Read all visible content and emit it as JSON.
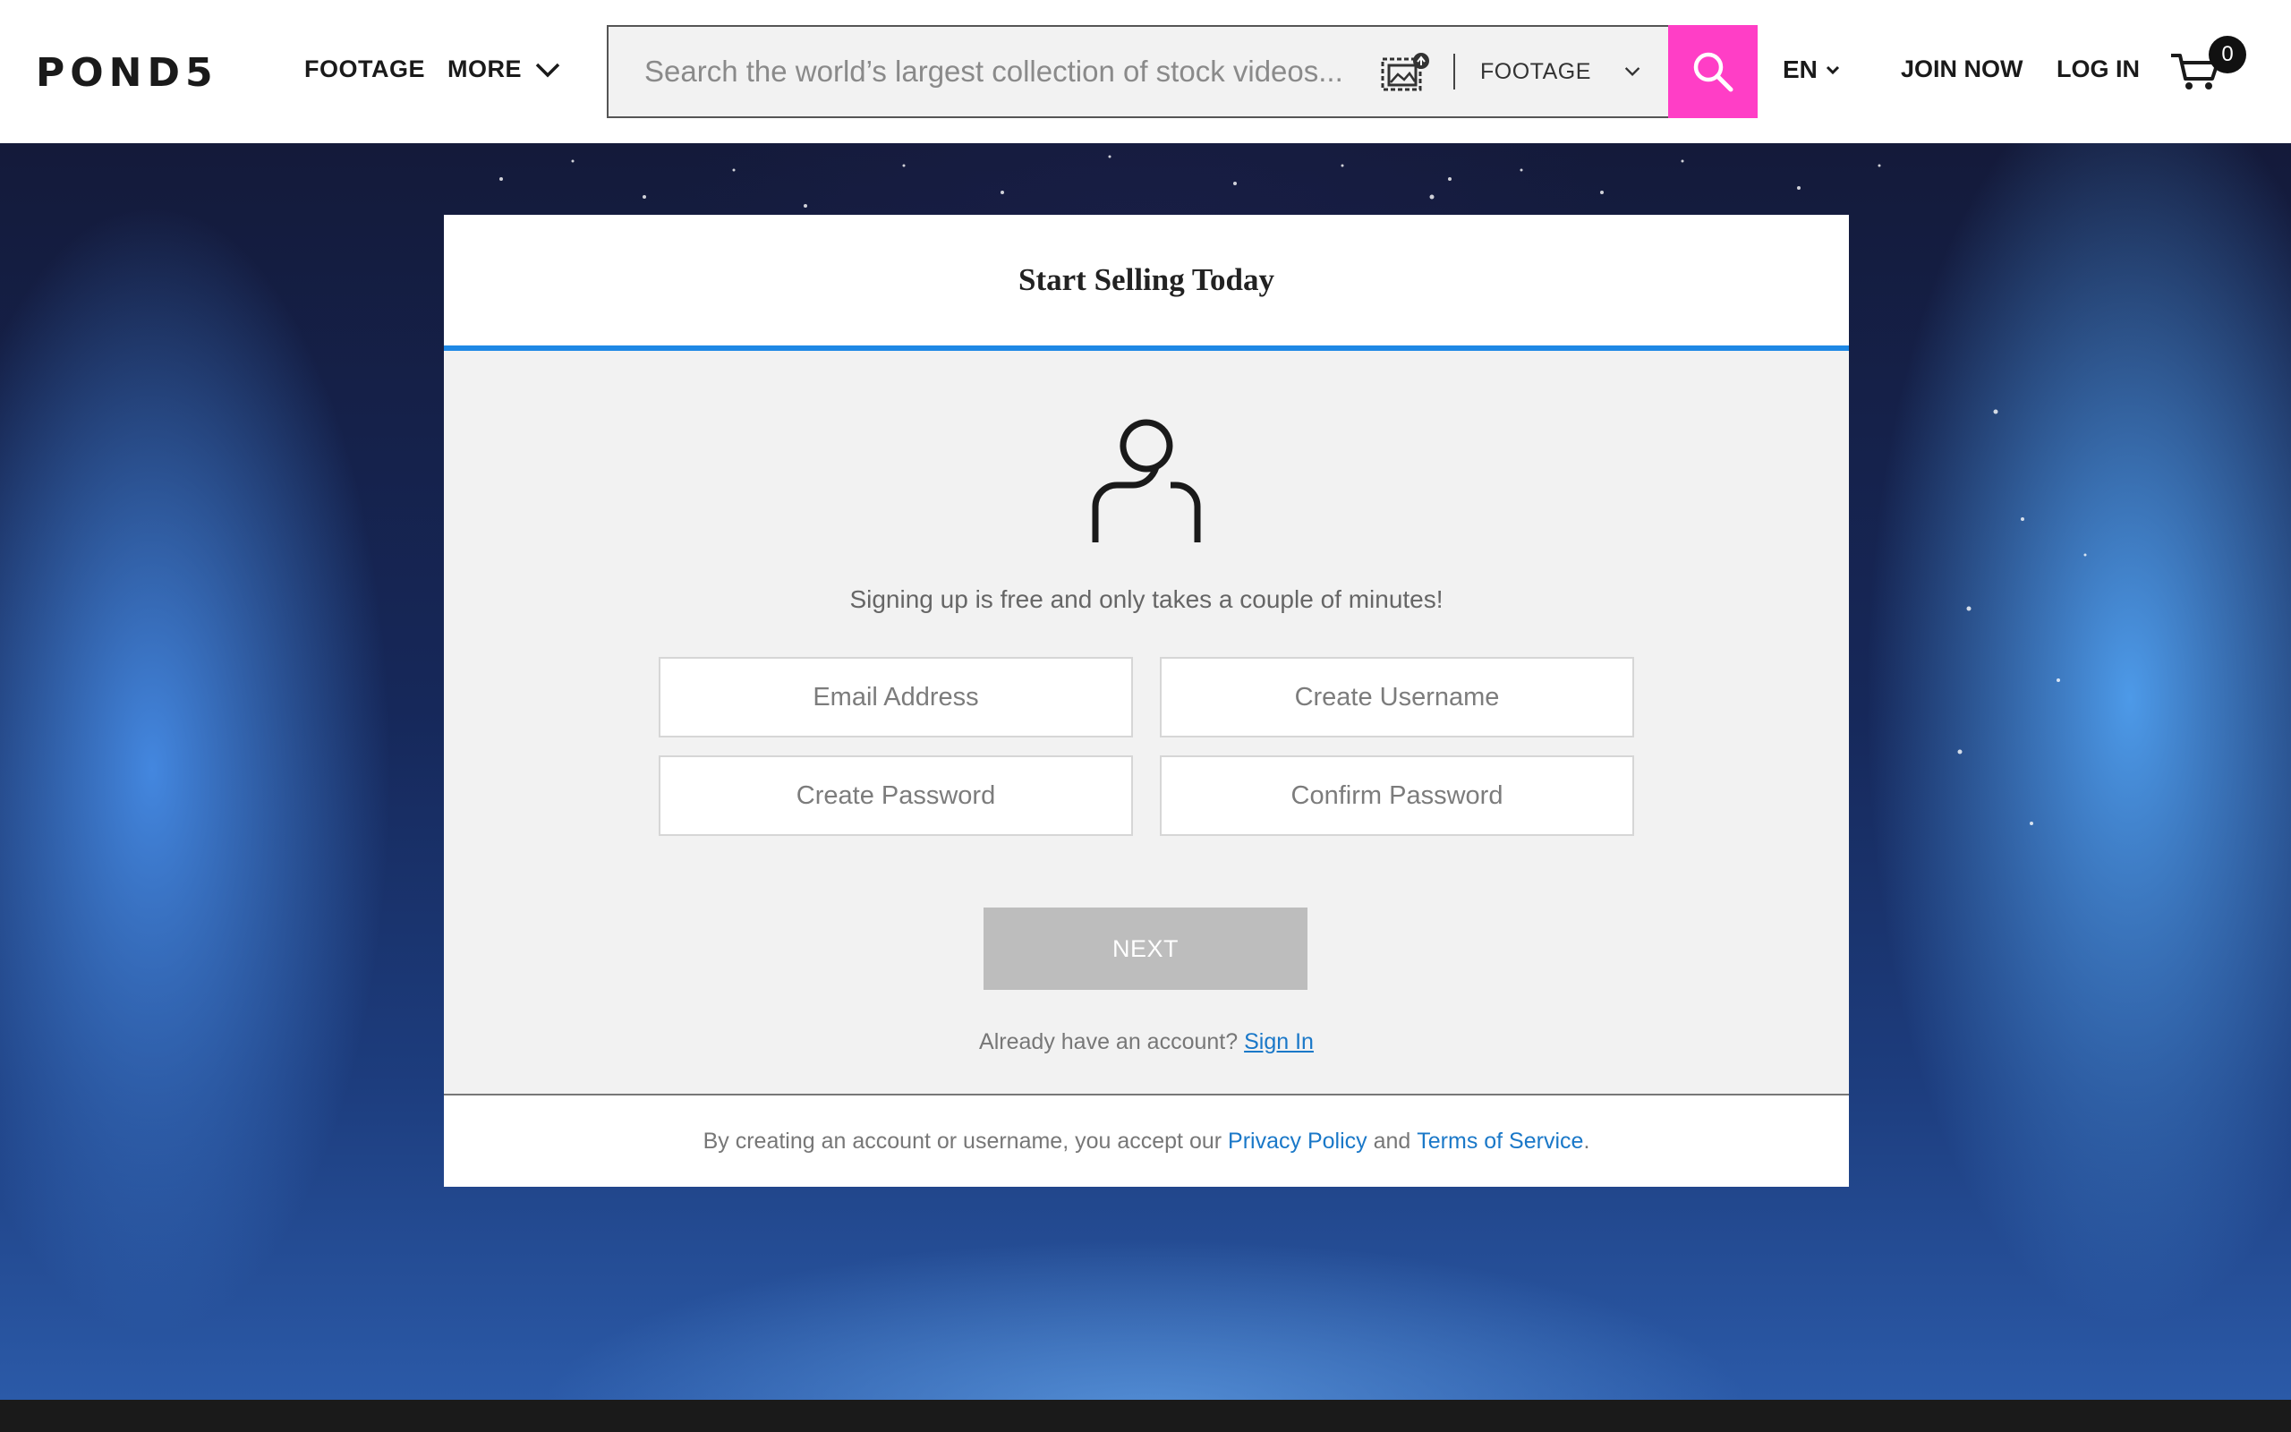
{
  "header": {
    "logo": "POND5",
    "nav_footage": "FOOTAGE",
    "nav_more": "MORE",
    "search_placeholder": "Search the world’s largest collection of stock videos...",
    "search_type": "FOOTAGE",
    "language": "EN",
    "join_now": "JOIN NOW",
    "log_in": "LOG IN",
    "cart_count": "0",
    "accent_color": "#ff3ec6"
  },
  "card": {
    "title": "Start Selling Today",
    "subtitle": "Signing up is free and only takes a couple of minutes!",
    "fields": {
      "email": "Email Address",
      "username": "Create Username",
      "password": "Create Password",
      "confirm": "Confirm Password"
    },
    "next_label": "NEXT",
    "have_account_text": "Already have an account?",
    "sign_in_label": "Sign In",
    "legal_prefix": "By creating an account or username, you accept our",
    "privacy_label": "Privacy Policy",
    "legal_and": "and",
    "terms_label": "Terms of Service",
    "legal_suffix": ".",
    "accent_color": "#1e88e5"
  },
  "icons": {
    "image_search": "image-search-icon",
    "search": "search-icon",
    "cart": "cart-icon",
    "avatar": "user-icon"
  }
}
